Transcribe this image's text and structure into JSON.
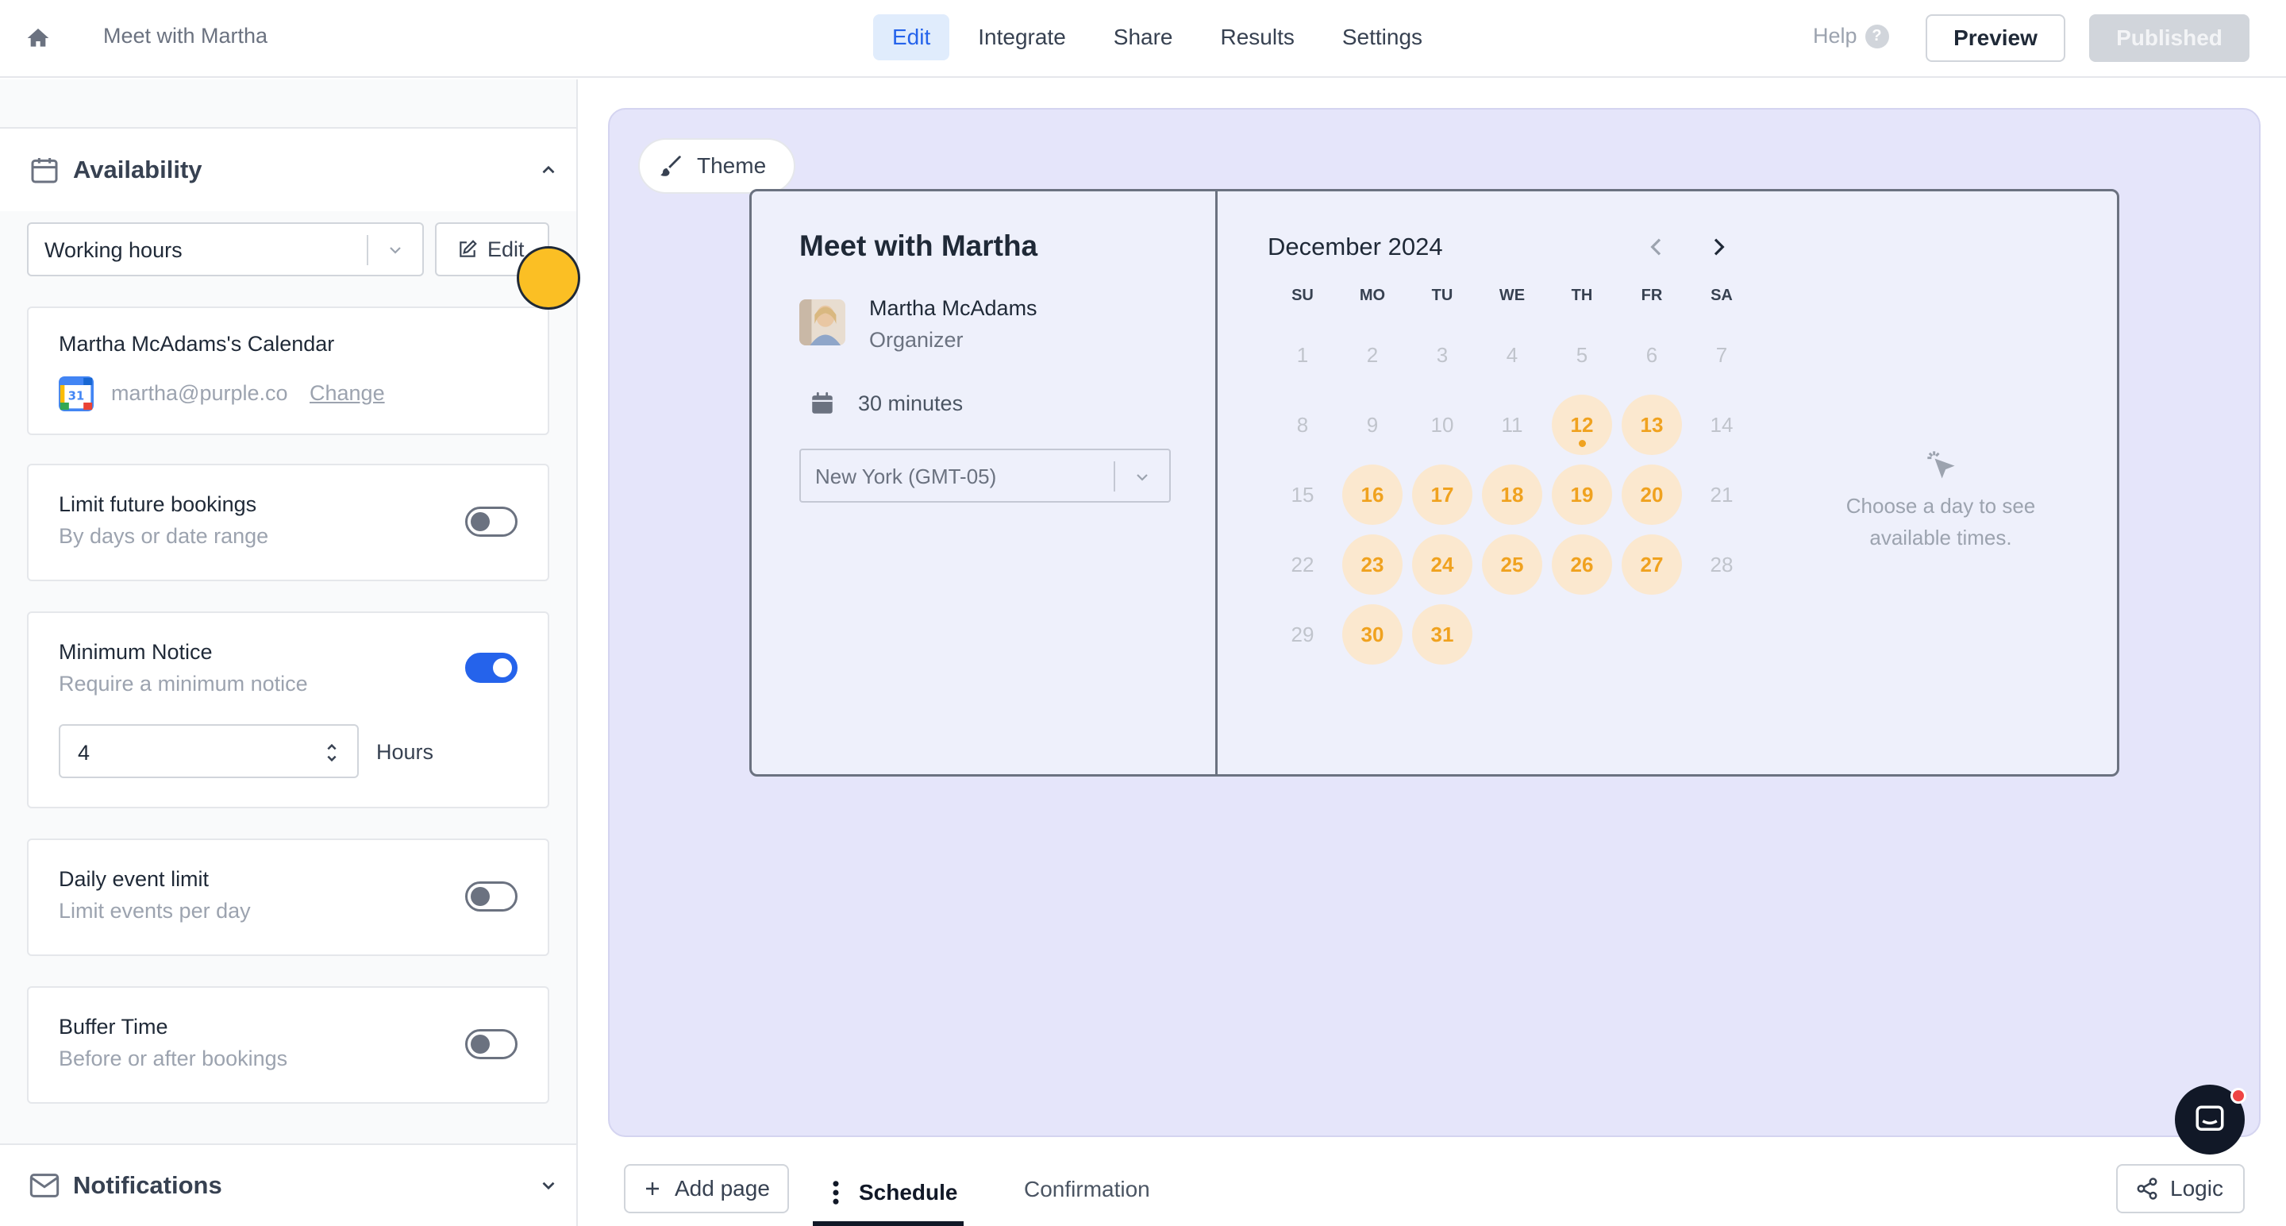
{
  "topbar": {
    "form_title": "Meet with Martha",
    "nav": [
      "Edit",
      "Integrate",
      "Share",
      "Results",
      "Settings"
    ],
    "help": "Help",
    "preview": "Preview",
    "published": "Published"
  },
  "left": {
    "availability_title": "Availability",
    "schedule_select": "Working hours",
    "edit_label": "Edit",
    "calendar": {
      "title": "Martha McAdams's Calendar",
      "email": "martha@purple.co",
      "change": "Change"
    },
    "limit_future": {
      "title": "Limit future bookings",
      "sub": "By days or date range",
      "on": false
    },
    "min_notice": {
      "title": "Minimum Notice",
      "sub": "Require a minimum notice",
      "on": true,
      "value": "4",
      "unit": "Hours"
    },
    "daily_limit": {
      "title": "Daily event limit",
      "sub": "Limit events per day",
      "on": false
    },
    "buffer": {
      "title": "Buffer Time",
      "sub": "Before or after bookings",
      "on": false
    },
    "notifications_title": "Notifications"
  },
  "canvas": {
    "theme_label": "Theme",
    "meeting_title": "Meet with Martha",
    "organizer_name": "Martha McAdams",
    "organizer_role": "Organizer",
    "duration": "30 minutes",
    "timezone": "New York (GMT-05)",
    "month": "December 2024",
    "weekdays": [
      "SU",
      "MO",
      "TU",
      "WE",
      "TH",
      "FR",
      "SA"
    ],
    "weeks": [
      [
        "1",
        "2",
        "3",
        "4",
        "5",
        "6",
        "7"
      ],
      [
        "8",
        "9",
        "10",
        "11",
        "12",
        "13",
        "14"
      ],
      [
        "15",
        "16",
        "17",
        "18",
        "19",
        "20",
        "21"
      ],
      [
        "22",
        "23",
        "24",
        "25",
        "26",
        "27",
        "28"
      ],
      [
        "29",
        "30",
        "31"
      ]
    ],
    "available_days": [
      "12",
      "13",
      "16",
      "17",
      "18",
      "19",
      "20",
      "23",
      "24",
      "25",
      "26",
      "27",
      "30",
      "31"
    ],
    "today": "12",
    "choose_text": "Choose a day to see available times.",
    "accent_color": "#f0a21f"
  },
  "bottom": {
    "add_page": "Add page",
    "tabs": [
      "Schedule",
      "Confirmation"
    ],
    "logic": "Logic"
  }
}
